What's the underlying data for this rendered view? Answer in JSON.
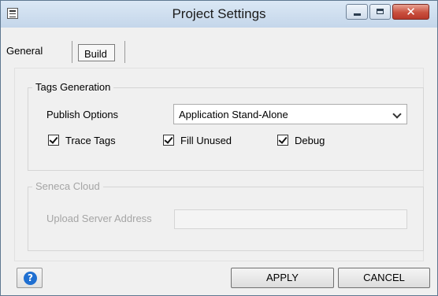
{
  "window": {
    "title": "Project Settings",
    "close_glyph": "✕",
    "help_glyph": "?"
  },
  "icons": {
    "app": "app-settings-icon",
    "minimize": "minimize-icon",
    "maximize": "maximize-icon",
    "close": "close-icon",
    "help": "help-icon",
    "dropdown": "chevron-down-icon"
  },
  "tabs": [
    {
      "label": "General",
      "selected": false
    },
    {
      "label": "Build",
      "selected": true
    }
  ],
  "tags_generation": {
    "legend": "Tags Generation",
    "publish_label": "Publish Options",
    "publish_value": "Application Stand-Alone",
    "checkboxes": [
      {
        "label": "Trace Tags",
        "checked": true
      },
      {
        "label": "Fill Unused",
        "checked": true
      },
      {
        "label": "Debug",
        "checked": true
      }
    ]
  },
  "seneca_cloud": {
    "legend": "Seneca Cloud",
    "upload_label": "Upload Server Address",
    "upload_value": "",
    "disabled": true
  },
  "buttons": {
    "apply": "APPLY",
    "cancel": "CANCEL"
  },
  "colors": {
    "help_accent": "#1f6fd1",
    "close_button": "#c9503e",
    "disabled_text": "#a5a5a5"
  }
}
